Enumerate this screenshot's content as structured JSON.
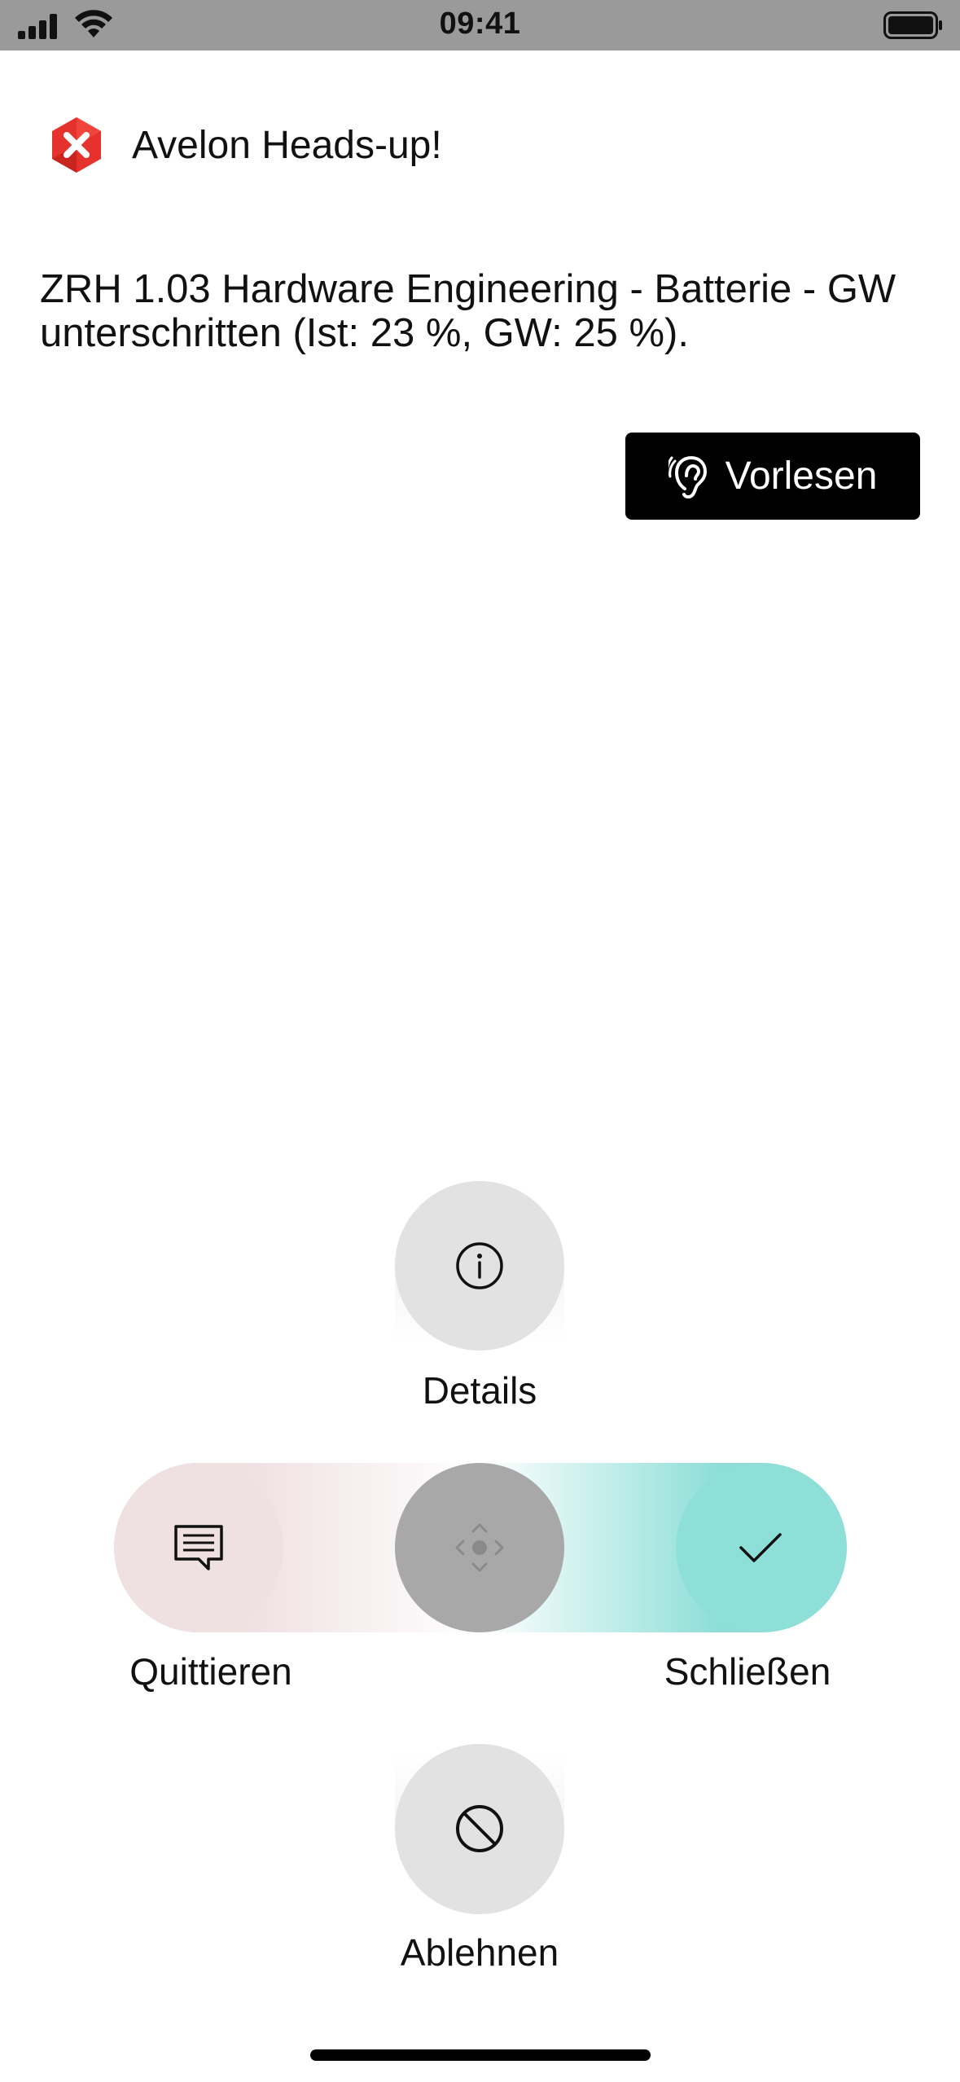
{
  "status_bar": {
    "time": "09:41",
    "icons": [
      "signal-icon",
      "wifi-icon",
      "battery-icon"
    ]
  },
  "header": {
    "logo_icon": "close-x-shield-icon",
    "title": "Avelon Heads-up!"
  },
  "alert": {
    "message": "ZRH 1.03 Hardware Engineering - Batterie - GW unterschritten (Ist: 23 %, GW: 25 %)."
  },
  "read_button": {
    "icon": "ear-icon",
    "label": "Vorlesen"
  },
  "actions": {
    "details": {
      "label": "Details",
      "icon": "info-icon"
    },
    "acknowledge": {
      "label": "Quittieren",
      "icon": "message-icon"
    },
    "center": {
      "icon": "drag-handle-icon"
    },
    "close": {
      "label": "Schließen",
      "icon": "checkmark-icon"
    },
    "reject": {
      "label": "Ablehnen",
      "icon": "prohibited-icon"
    }
  },
  "colors": {
    "logo_red": "#e5322d",
    "close_teal": "#8edfd8",
    "acknowledge_pink": "#efe0e2",
    "neutral_gray": "#e2e2e2",
    "center_gray": "#a8a8a8",
    "button_black": "#000000"
  }
}
